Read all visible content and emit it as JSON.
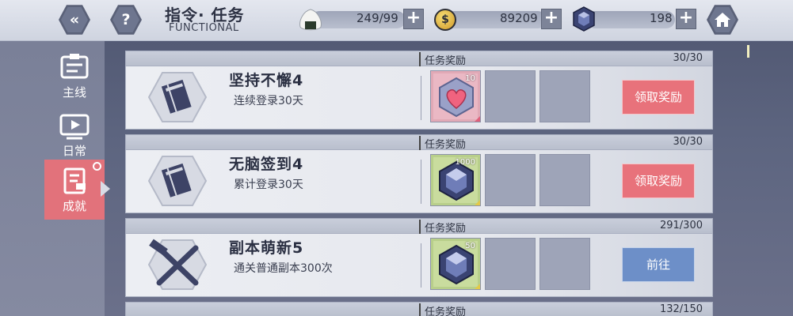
{
  "header": {
    "title": "指令· 任务",
    "subtitle": "FUNCTIONAL",
    "back_icon": "«",
    "help_icon": "?",
    "resources": [
      {
        "name": "rice-ball-icon",
        "value": "249/99"
      },
      {
        "name": "gold-coin-icon",
        "value": "89209",
        "glyph": "$"
      },
      {
        "name": "crystal-icon",
        "value": "198"
      }
    ],
    "plus_label": "+"
  },
  "sidebar": {
    "items": [
      {
        "label": "主线",
        "icon": "mainline-icon"
      },
      {
        "label": "日常",
        "icon": "daily-icon"
      },
      {
        "label": "成就",
        "icon": "achievement-icon",
        "active": true
      }
    ]
  },
  "tasks": [
    {
      "header_label": "任务奖励",
      "progress": "30/30",
      "name": "坚持不懈4",
      "desc": "连续登录30天",
      "icon": "notebook-icon",
      "reward": {
        "icon": "heart-box-icon",
        "qty": "10"
      },
      "action": "领取奖励"
    },
    {
      "header_label": "任务奖励",
      "progress": "30/30",
      "name": "无脑签到4",
      "desc": "累计登录30天",
      "icon": "notebook-icon",
      "reward": {
        "icon": "crystal-icon",
        "qty": "1000"
      },
      "action": "领取奖励"
    },
    {
      "header_label": "任务奖励",
      "progress": "291/300",
      "name": "副本萌新5",
      "desc": "通关普通副本300次",
      "icon": "crossed-weapons-icon",
      "reward": {
        "icon": "crystal-icon",
        "qty": "50"
      },
      "action": "前往"
    },
    {
      "header_label": "任务奖励",
      "progress": "132/150"
    }
  ],
  "colors": {
    "claim": "#e8727b",
    "go": "#6d8fc8",
    "active_tab": "#e2727b"
  }
}
